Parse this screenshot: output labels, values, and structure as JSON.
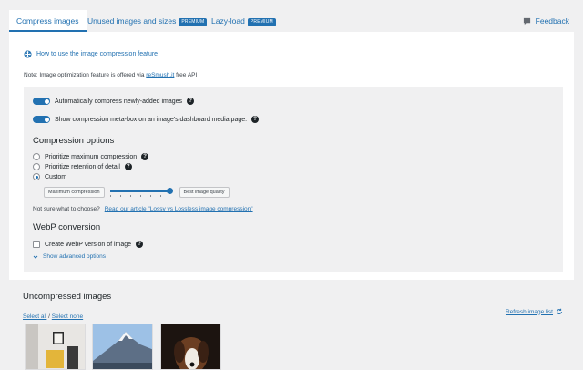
{
  "tabs": [
    {
      "label": "Compress images",
      "active": true
    },
    {
      "label": "Unused images and sizes",
      "badge": "PREMIUM"
    },
    {
      "label": "Lazy-load",
      "badge": "PREMIUM"
    }
  ],
  "feedback_label": "Feedback",
  "howto_link": "How to use the image compression feature",
  "note": {
    "prefix": "Note: Image optimization feature is offered via ",
    "link": "reSmush.it",
    "suffix": " free API"
  },
  "toggles": [
    {
      "label": "Automatically compress newly-added images",
      "on": true
    },
    {
      "label": "Show compression meta-box on an image's dashboard media page.",
      "on": true
    }
  ],
  "compression": {
    "heading": "Compression options",
    "options": [
      {
        "label": "Prioritize maximum compression",
        "selected": false,
        "help": true
      },
      {
        "label": "Prioritize retention of detail",
        "selected": false,
        "help": true
      },
      {
        "label": "Custom",
        "selected": true,
        "help": false
      }
    ],
    "slider_min_label": "Maximum compression",
    "slider_max_label": "Best image quality",
    "slider_level": 1.0,
    "not_sure_prefix": "Not sure what to choose? ",
    "not_sure_link": "Read our article \"Lossy vs Lossless image compression\""
  },
  "webp": {
    "heading": "WebP conversion",
    "checkbox_label": "Create WebP version of image",
    "checked": false,
    "advanced_link": "Show advanced options"
  },
  "uncompressed": {
    "heading": "Uncompressed images",
    "select_all": "Select all",
    "separator": " / ",
    "select_none": "Select none",
    "refresh": "Refresh image list"
  },
  "colors": {
    "accent": "#2271b1",
    "bg": "#f0f0f1"
  },
  "icons": [
    "feedback-icon",
    "help-circle-icon",
    "refresh-icon",
    "chevron-down-icon",
    "compression-icon"
  ]
}
